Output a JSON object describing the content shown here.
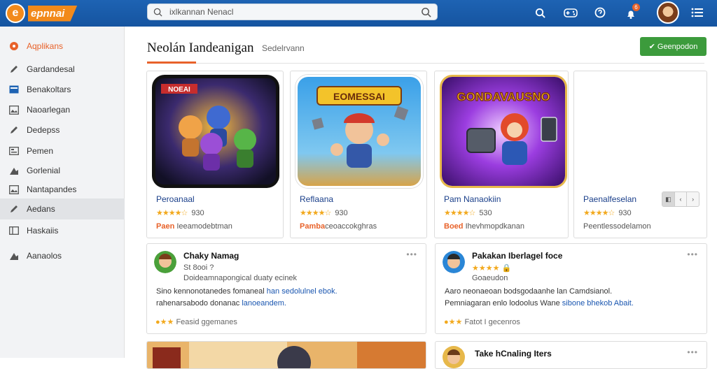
{
  "app": {
    "brand": "epnnai"
  },
  "search": {
    "query": "ixlkannan Nenacl"
  },
  "topbar": {
    "notif_count": "6"
  },
  "sidebar": {
    "items": [
      {
        "label": "Aqplikans",
        "icon": "app-logo-icon"
      },
      {
        "label": "Gardandesal",
        "icon": "pencil-icon"
      },
      {
        "label": "Benakoltars",
        "icon": "card-icon"
      },
      {
        "label": "Naoarlegan",
        "icon": "image-icon"
      },
      {
        "label": "Dedepss",
        "icon": "pencil-icon"
      },
      {
        "label": "Pemen",
        "icon": "list-icon"
      },
      {
        "label": "Gorlenial",
        "icon": "chart-icon"
      },
      {
        "label": "Nantapandes",
        "icon": "photo-icon"
      },
      {
        "label": "Aedans",
        "icon": "pencil-icon"
      },
      {
        "label": "Haskaiis",
        "icon": "grid-icon"
      },
      {
        "label": "Aanaolos",
        "icon": "tag-icon"
      }
    ]
  },
  "page": {
    "title": "Neolán Iandeanigan",
    "subtitle": "Sedelrvann",
    "download_label": "✔ Geenpodon"
  },
  "cards": [
    {
      "name": "Peroanaal",
      "rating": "★★★★☆",
      "count": "930",
      "tag_strong": "Paen",
      "tag": "Ieeamodebtman",
      "thumb_text": "NOEAI"
    },
    {
      "name": "Reflaana",
      "rating": "★★★★☆",
      "count": "930",
      "tag_strong": "Pamba",
      "tag": "ceoaccokghras",
      "thumb_text": "EOMESSAI"
    },
    {
      "name": "Pam Nanaokiin",
      "rating": "★★★★☆",
      "count": "530",
      "tag_strong": "Boed",
      "tag": "Ihevhmopdkanan",
      "thumb_text": "GONDAVAUSNO"
    },
    {
      "name": "Paenalfeselan",
      "rating": "★★★★☆",
      "count": "930",
      "tag_strong": "",
      "tag": "Peentlessodelamon",
      "pager": [
        "◧",
        "‹",
        "›"
      ]
    }
  ],
  "reviews": [
    {
      "name": "Chaky Namag",
      "line2": "St 8ooi ?",
      "line3": "Doideamnapongical duaty ecinek",
      "body1": "Sino kennonotanedes fomaneal",
      "link1": "han sedolulnel ebok.",
      "body2": "rahenarsabodo donanac",
      "link2": "lanoeandem.",
      "footer": "Feasid ggemanes"
    },
    {
      "name": "Pakakan Iberlagel foce",
      "line2": "★★★★ 🔒",
      "line3": "Goaeudon",
      "body1": "Aaro neonaeoan bodsgodaanhe lan Camdsianol.",
      "link1": "",
      "body2": "Pemniagaran enlo lodoolus Wane",
      "link2": "sibone bhekob Abait.",
      "footer": "Fatot I gecenros"
    }
  ],
  "bottom": {
    "right_name": "Take hCnaling Iters"
  }
}
